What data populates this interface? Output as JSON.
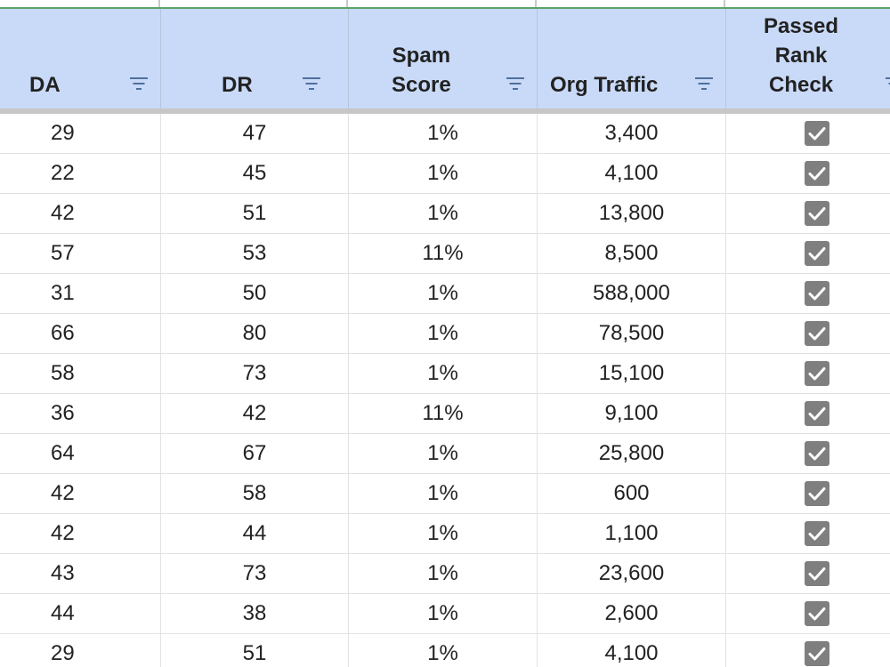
{
  "colors": {
    "header_bg": "#c9daf8",
    "top_border": "#5aa469",
    "checkbox_fill": "#7f7f7f",
    "filter_icon": "#4f6f9e"
  },
  "icons": {
    "filter": "filter-icon",
    "checkbox": "checked-checkbox-icon"
  },
  "header": {
    "da": {
      "lines": [
        "DA"
      ]
    },
    "dr": {
      "lines": [
        "DR"
      ]
    },
    "spam": {
      "lines": [
        "Spam",
        "Score"
      ]
    },
    "org": {
      "lines": [
        "Org Traffic"
      ]
    },
    "rank": {
      "lines": [
        "Passed",
        "Rank",
        "Check"
      ]
    }
  },
  "rows": [
    {
      "da": "29",
      "dr": "47",
      "spam": "1%",
      "org": "3,400",
      "rank": true
    },
    {
      "da": "22",
      "dr": "45",
      "spam": "1%",
      "org": "4,100",
      "rank": true
    },
    {
      "da": "42",
      "dr": "51",
      "spam": "1%",
      "org": "13,800",
      "rank": true
    },
    {
      "da": "57",
      "dr": "53",
      "spam": "11%",
      "org": "8,500",
      "rank": true
    },
    {
      "da": "31",
      "dr": "50",
      "spam": "1%",
      "org": "588,000",
      "rank": true
    },
    {
      "da": "66",
      "dr": "80",
      "spam": "1%",
      "org": "78,500",
      "rank": true
    },
    {
      "da": "58",
      "dr": "73",
      "spam": "1%",
      "org": "15,100",
      "rank": true
    },
    {
      "da": "36",
      "dr": "42",
      "spam": "11%",
      "org": "9,100",
      "rank": true
    },
    {
      "da": "64",
      "dr": "67",
      "spam": "1%",
      "org": "25,800",
      "rank": true
    },
    {
      "da": "42",
      "dr": "58",
      "spam": "1%",
      "org": "600",
      "rank": true
    },
    {
      "da": "42",
      "dr": "44",
      "spam": "1%",
      "org": "1,100",
      "rank": true
    },
    {
      "da": "43",
      "dr": "73",
      "spam": "1%",
      "org": "23,600",
      "rank": true
    },
    {
      "da": "44",
      "dr": "38",
      "spam": "1%",
      "org": "2,600",
      "rank": true
    },
    {
      "da": "29",
      "dr": "51",
      "spam": "1%",
      "org": "4,100",
      "rank": true
    }
  ]
}
